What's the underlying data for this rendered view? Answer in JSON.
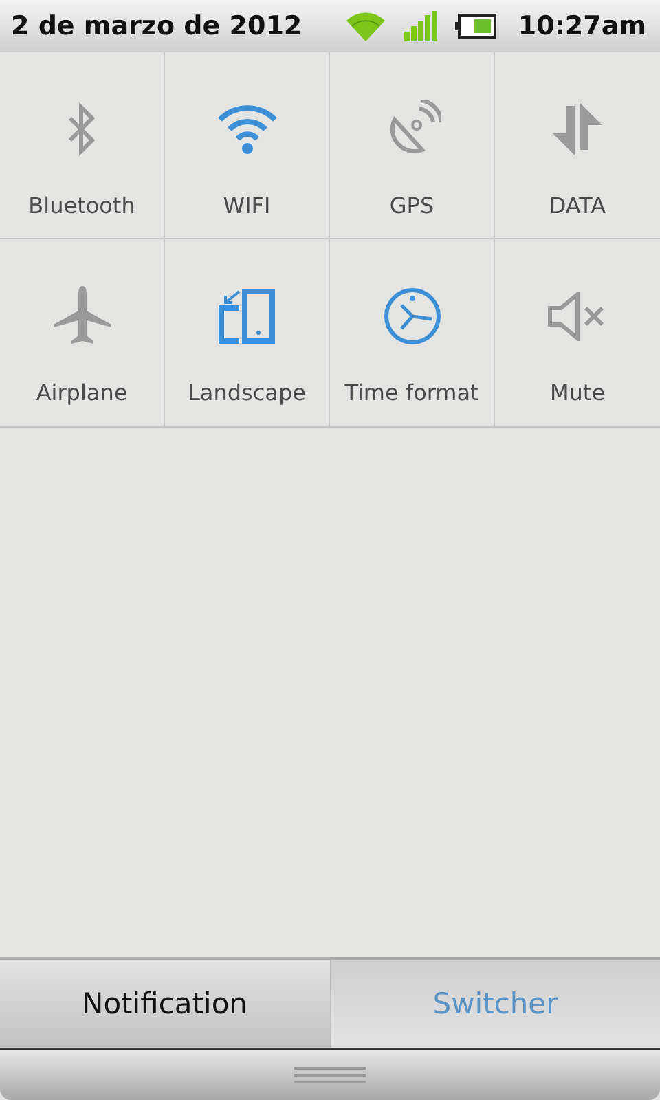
{
  "status_bar": {
    "date": "2 de marzo de 2012",
    "time": "10:27am"
  },
  "toggles": [
    {
      "kind": "bluetooth",
      "label": "Bluetooth",
      "on": false
    },
    {
      "kind": "wifi",
      "label": "WIFI",
      "on": true
    },
    {
      "kind": "gps",
      "label": "GPS",
      "on": false
    },
    {
      "kind": "data",
      "label": "DATA",
      "on": false
    },
    {
      "kind": "airplane",
      "label": "Airplane",
      "on": false
    },
    {
      "kind": "rotation",
      "label": "Landscape",
      "on": true
    },
    {
      "kind": "clock",
      "label": "Time format",
      "on": true
    },
    {
      "kind": "mute",
      "label": "Mute",
      "on": false
    }
  ],
  "tabs": [
    {
      "label": "Notification",
      "selected": false
    },
    {
      "label": "Switcher",
      "selected": true
    }
  ]
}
